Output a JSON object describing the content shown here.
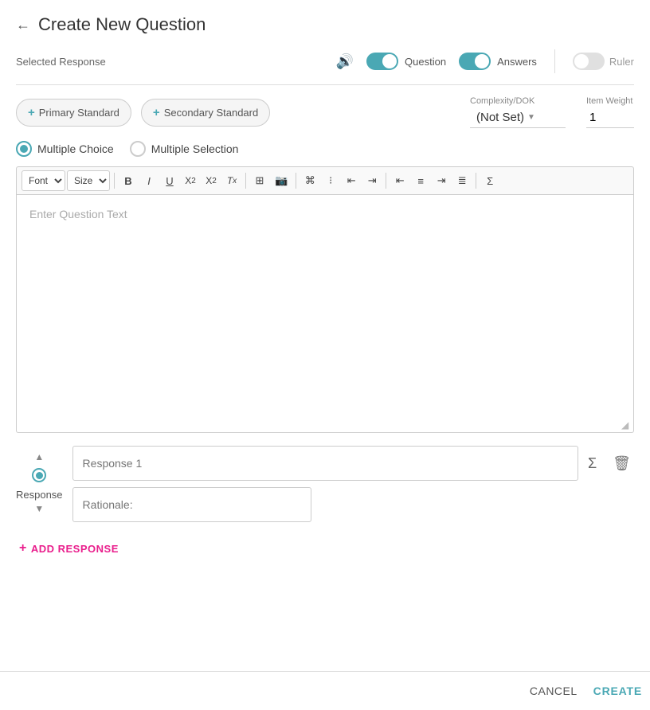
{
  "header": {
    "back_arrow": "←",
    "title": "Create New Question"
  },
  "selected_response": {
    "label": "Selected Response",
    "speaker_icon": "🔊",
    "question_toggle": {
      "label": "Question",
      "on": true
    },
    "answers_toggle": {
      "label": "Answers",
      "on": true
    },
    "ruler_toggle": {
      "label": "Ruler",
      "on": false
    }
  },
  "standards": {
    "primary_btn": "Primary Standard",
    "secondary_btn": "Secondary Standard",
    "complexity_label": "Complexity/DOK",
    "complexity_value": "(Not Set)",
    "item_weight_label": "Item Weight",
    "item_weight_value": "1"
  },
  "question_types": {
    "multiple_choice": "Multiple Choice",
    "multiple_selection": "Multiple Selection"
  },
  "toolbar": {
    "font_label": "Font",
    "size_label": "Size",
    "bold": "B",
    "italic": "I",
    "underline": "U",
    "subscript": "X₂",
    "superscript": "X²",
    "clear_format": "Tx",
    "table": "⊞",
    "image": "🖼",
    "ordered_list": "1.",
    "unordered_list": "•",
    "decrease_indent": "⇤",
    "increase_indent": "⇥",
    "align_left": "≡",
    "align_center": "≡",
    "align_right": "≡",
    "justify": "≡",
    "formula": "Σ"
  },
  "editor": {
    "placeholder": "Enter Question Text"
  },
  "response": {
    "label": "Response",
    "response1_placeholder": "Response 1",
    "rationale_placeholder": "Rationale:"
  },
  "add_response": {
    "label": "ADD RESPONSE"
  },
  "footer": {
    "cancel_label": "CANCEL",
    "create_label": "CREATE"
  }
}
